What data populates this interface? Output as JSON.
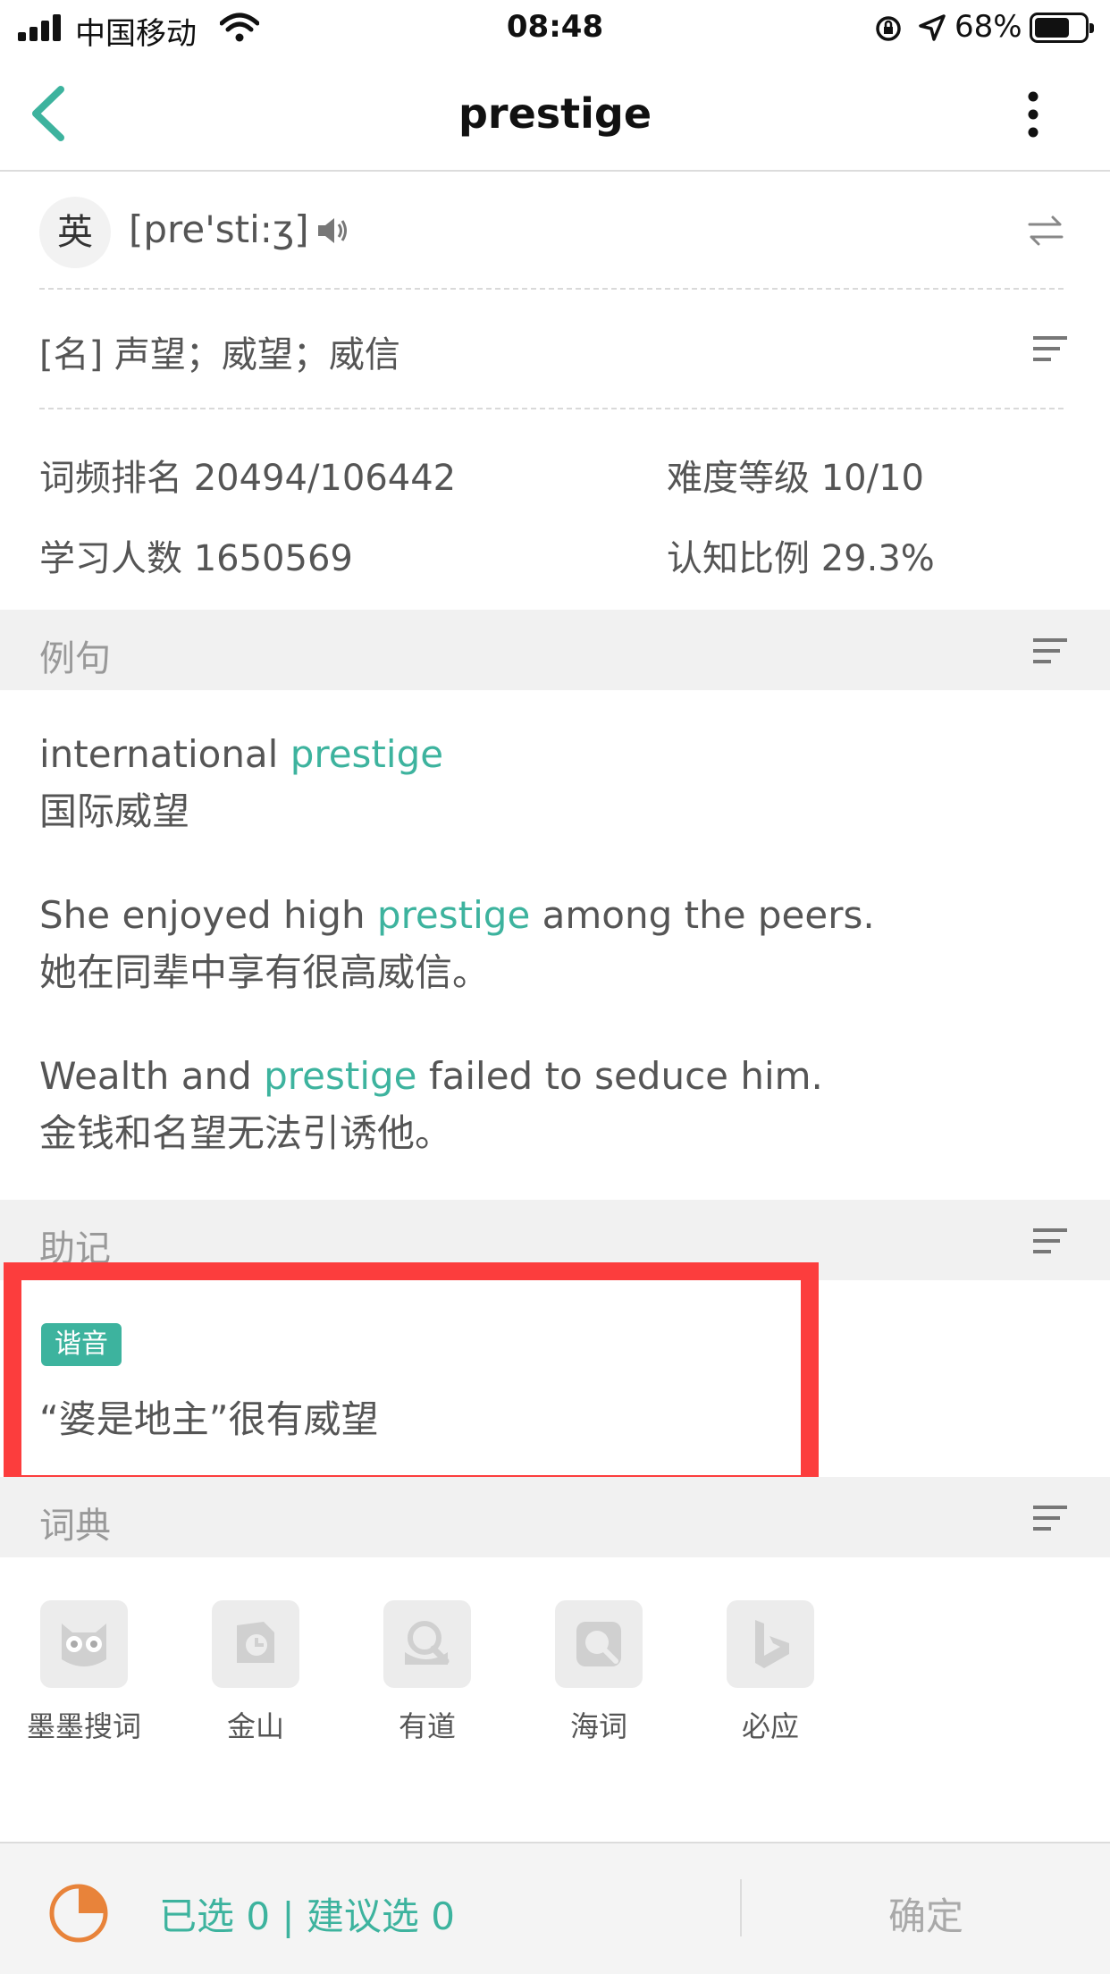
{
  "status_bar": {
    "carrier": "中国移动",
    "time": "08:48",
    "battery": "68%"
  },
  "nav": {
    "title": "prestige"
  },
  "pronunciation": {
    "region": "英",
    "phonetic": "[pre'sti:ʒ]"
  },
  "definition": "[名] 声望；威望；威信",
  "stats": {
    "freq_rank": "词频排名 20494/106442",
    "difficulty": "难度等级 10/10",
    "learners": "学习人数 1650569",
    "recognition": "认知比例 29.3%"
  },
  "sections": {
    "examples": "例句",
    "mnemonic": "助记",
    "dictionary": "词典"
  },
  "examples": [
    {
      "pre": "international ",
      "hl": "prestige",
      "post": "",
      "zh": "国际威望"
    },
    {
      "pre": "She enjoyed high ",
      "hl": "prestige",
      "post": " among the peers.",
      "zh": "她在同辈中享有很高威信。"
    },
    {
      "pre": "Wealth and ",
      "hl": "prestige",
      "post": " failed to seduce him.",
      "zh": "金钱和名望无法引诱他。"
    }
  ],
  "mnemonic": {
    "tag": "谐音",
    "text": "“婆是地主”很有威望"
  },
  "dictionaries": [
    {
      "label": "墨墨搜词",
      "icon": "owl-icon"
    },
    {
      "label": "金山",
      "icon": "kingsoft-icon"
    },
    {
      "label": "有道",
      "icon": "youdao-icon"
    },
    {
      "label": "海词",
      "icon": "dict-cn-icon"
    },
    {
      "label": "必应",
      "icon": "bing-icon"
    }
  ],
  "bottom": {
    "selected": "已选 0 | 建议选 0",
    "confirm": "确定"
  },
  "colors": {
    "accent": "#3db39e",
    "highlight_box": "#fc3d3d",
    "pie": "#e8833a"
  }
}
